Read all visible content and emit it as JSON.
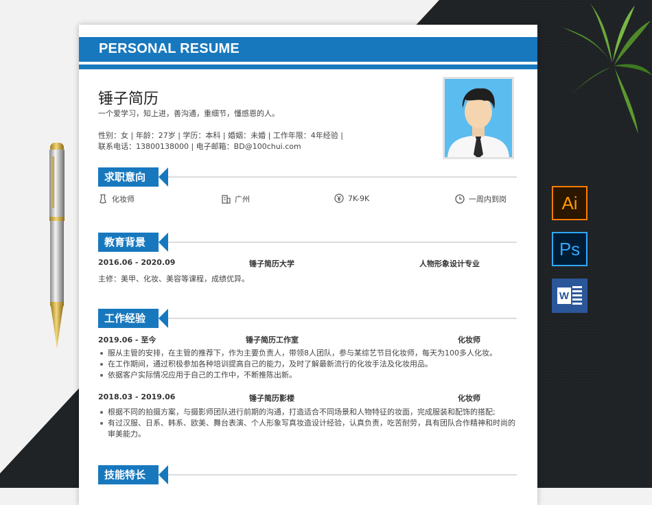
{
  "banner": {
    "title": "PERSONAL RESUME"
  },
  "profile": {
    "name": "锤子简历",
    "motto": "一个爱学习，知上进，善沟通，重细节，懂感恩的人。",
    "info_line1": "性别：女 | 年龄：27岁 | 学历：本科 | 婚姻：未婚 | 工作年限：4年经验 |",
    "info_line2": "联系电话：13800138000 | 电子邮箱：BD@100chui.com"
  },
  "sections": {
    "job": "求职意向",
    "education": "教育背景",
    "work": "工作经验",
    "skills": "技能特长"
  },
  "job_intent": {
    "position": "化妆师",
    "city": "广州",
    "salary": "7K-9K",
    "availability": "一周内到岗"
  },
  "education": {
    "period": "2016.06 - 2020.09",
    "school": "锤子简历大学",
    "major": "人物形象设计专业",
    "courses": "主修：美甲、化妆、美容等课程，成绩优异。"
  },
  "work": [
    {
      "period": "2019.06 - 至今",
      "company": "锤子简历工作室",
      "role": "化妆师",
      "bullets": [
        "服从主管的安排，在主管的推荐下，作为主要负责人，带领8人团队，参与某综艺节目化妆师，每天为100多人化妆。",
        "在工作期间，通过积极参加各种培训提高自己的能力，及时了解最新流行的化妆手法及化妆用品。",
        "依据客户实际情况应用于自己的工作中，不断推陈出新。"
      ]
    },
    {
      "period": "2018.03 - 2019.06",
      "company": "锤子简历影楼",
      "role": "化妆师",
      "bullets": [
        "根据不同的拍摄方案，与摄影师团队进行前期的沟通，打造适合不同场景和人物特征的妆面，完成服装和配饰的搭配;",
        "有过汉服、日系、韩系、欧美、舞台表演、个人形象写真妆造设计经验，认真负责，吃苦耐劳，具有团队合作精神和时尚的审美能力。"
      ]
    }
  ],
  "app_icons": {
    "ai": "Ai",
    "ps": "Ps",
    "word": "W"
  },
  "colors": {
    "accent": "#1878be",
    "background_dark": "#1f2225"
  }
}
